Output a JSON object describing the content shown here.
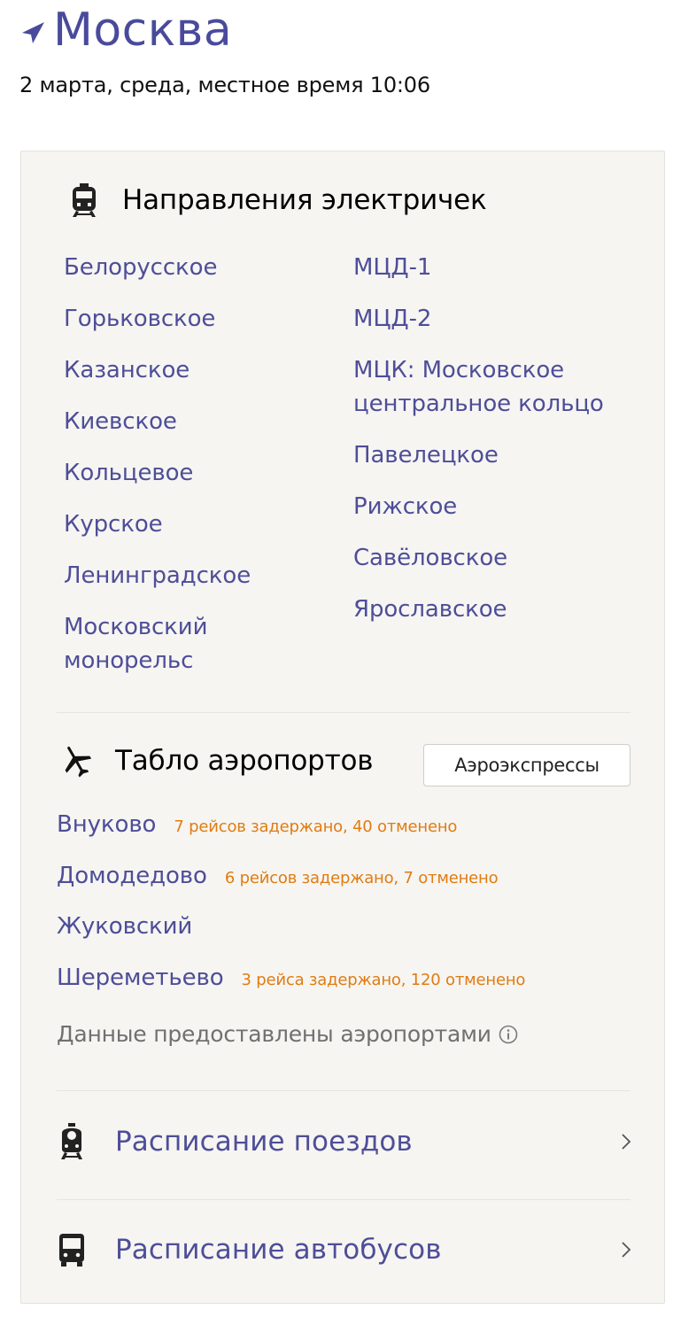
{
  "header": {
    "city": "Москва",
    "date_line": "2 марта, среда, местное время 10:06"
  },
  "directions": {
    "title": "Направления электричек",
    "left": [
      "Белорусское",
      "Горьковское",
      "Казанское",
      "Киевское",
      "Кольцевое",
      "Курское",
      "Ленинградское",
      "Московский монорельс"
    ],
    "right": [
      "МЦД-1",
      "МЦД-2",
      "МЦК: Московское центральное кольцо",
      "Павелецкое",
      "Рижское",
      "Савёловское",
      "Ярославское"
    ]
  },
  "airports": {
    "title": "Табло аэропортов",
    "button_label": "Аэроэкспрессы",
    "list": [
      {
        "name": "Внуково",
        "status": "7 рейсов задержано, 40 отменено"
      },
      {
        "name": "Домодедово",
        "status": "6 рейсов задержано, 7 отменено"
      },
      {
        "name": "Жуковский",
        "status": ""
      },
      {
        "name": "Шереметьево",
        "status": "3 рейса задержано, 120 отменено"
      }
    ],
    "provided_by": "Данные предоставлены аэропортами"
  },
  "nav": {
    "trains_label": "Расписание поездов",
    "buses_label": "Расписание автобусов"
  },
  "colors": {
    "link": "#4e4e98",
    "city": "#4a4a9c",
    "status": "#e07c12",
    "card_bg": "#f6f5f2"
  }
}
